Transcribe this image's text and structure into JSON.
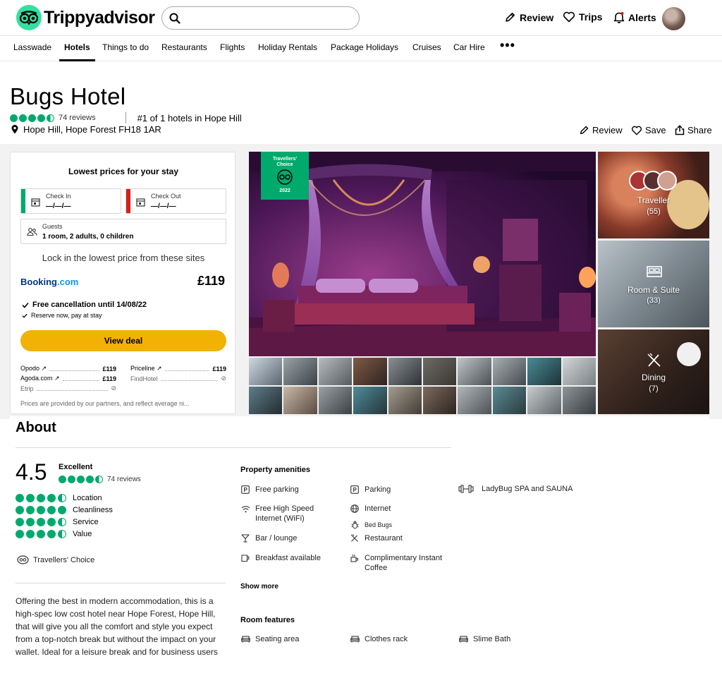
{
  "brand": {
    "name": "Trippyadvisor",
    "accent": "#34e0a1"
  },
  "search": {
    "placeholder": ""
  },
  "topnav": {
    "review": "Review",
    "trips": "Trips",
    "alerts": "Alerts"
  },
  "subnav": [
    "Lasswade",
    "Hotels",
    "Things to do",
    "Restaurants",
    "Flights",
    "Holiday Rentals",
    "Package Holidays",
    "Cruises",
    "Car Hire",
    "•••"
  ],
  "hotel": {
    "name": "Bugs Hotel",
    "rating": 4.5,
    "reviews": "74 reviews",
    "rank": "#1 of 1 hotels in Hope Hill",
    "address": "Hope Hill, Hope Forest FH18 1AR"
  },
  "actions": {
    "review": "Review",
    "save": "Save",
    "share": "Share"
  },
  "prices": {
    "title": "Lowest prices for your stay",
    "checkin_label": "Check In",
    "checkin_value": "—/—/—",
    "checkout_label": "Check Out",
    "checkout_value": "—/—/—",
    "guests_label": "Guests",
    "guests_value": "1 room, 2 adults, 0 children",
    "lock_text": "Lock in the lowest price from these sites",
    "provider_main": "Booking",
    "provider_main_suffix": ".com",
    "price_main": "£119",
    "free_cancel": "Free cancellation until 14/08/22",
    "reserve": "Reserve now, pay at stay",
    "view_deal": "View deal",
    "others": [
      {
        "name": "Opodo ↗",
        "price": "£119"
      },
      {
        "name": "Priceline ↗",
        "price": "£119"
      },
      {
        "name": "Agoda.com ↗",
        "price": "£119"
      },
      {
        "name": "FindHotel",
        "price": "⊘"
      },
      {
        "name": "Etrip",
        "price": "⊘"
      }
    ],
    "disclaimer": "Prices are provided by our partners, and reflect average ni..."
  },
  "gallery": {
    "award_line1": "Travellers'",
    "award_line2": "Choice",
    "award_year": "2022",
    "tiles": [
      {
        "label": "Traveller",
        "count": "(55)"
      },
      {
        "label": "Room & Suite",
        "count": "(33)"
      },
      {
        "label": "Dining",
        "count": "(7)"
      }
    ]
  },
  "about": {
    "title": "About",
    "score": "4.5",
    "score_word": "Excellent",
    "reviews": "74 reviews",
    "subratings": [
      {
        "label": "Location",
        "value": 4.5
      },
      {
        "label": "Cleanliness",
        "value": 5
      },
      {
        "label": "Service",
        "value": 4.5
      },
      {
        "label": "Value",
        "value": 4.5
      }
    ],
    "travellers_choice": "Travellers' Choice",
    "description": "Offering the best in modern accommodation, this is a high-spec low cost hotel near Hope Forest, Hope Hill, that will give you all the comfort and style you expect from a top-notch break but without the impact on your wallet. Ideal for a leisure break and for business users"
  },
  "amenities": {
    "title": "Property amenities",
    "items": [
      "Free parking",
      "Parking",
      "LadyBug SPA and SAUNA",
      "Free High Speed Internet (WiFi)",
      "Internet",
      "Bed Bugs",
      "Bar / lounge",
      "Restaurant",
      "Breakfast available",
      "Complimentary Instant Coffee"
    ],
    "show_more": "Show more"
  },
  "room_features": {
    "title": "Room features",
    "items": [
      "Seating area",
      "Clothes rack",
      "Slime Bath"
    ]
  }
}
